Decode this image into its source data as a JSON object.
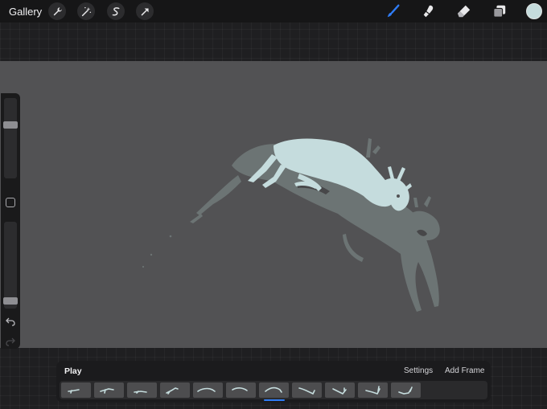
{
  "toolbar": {
    "gallery_label": "Gallery",
    "left_tools": [
      "wrench-icon",
      "magic-wand-icon",
      "selection-icon",
      "transform-icon"
    ],
    "right_tools": [
      "brush-icon",
      "smudge-icon",
      "eraser-icon",
      "layers-icon"
    ],
    "active_tool": "brush-icon",
    "current_color": "#c5dcdd",
    "accent_color": "#2f7cf6"
  },
  "sidebar": {
    "brush_size_level": 0.68,
    "opacity_level": 0.05,
    "modify_button": "square-icon",
    "undo_icon": "undo-icon",
    "redo_icon": "redo-icon"
  },
  "canvas": {
    "background_color": "#525254",
    "paint_color": "#c5dcdd",
    "onion_skin_color": "#6f7777"
  },
  "animation": {
    "play_label": "Play",
    "settings_label": "Settings",
    "add_frame_label": "Add Frame",
    "frame_count": 11,
    "selected_frame": 7
  }
}
